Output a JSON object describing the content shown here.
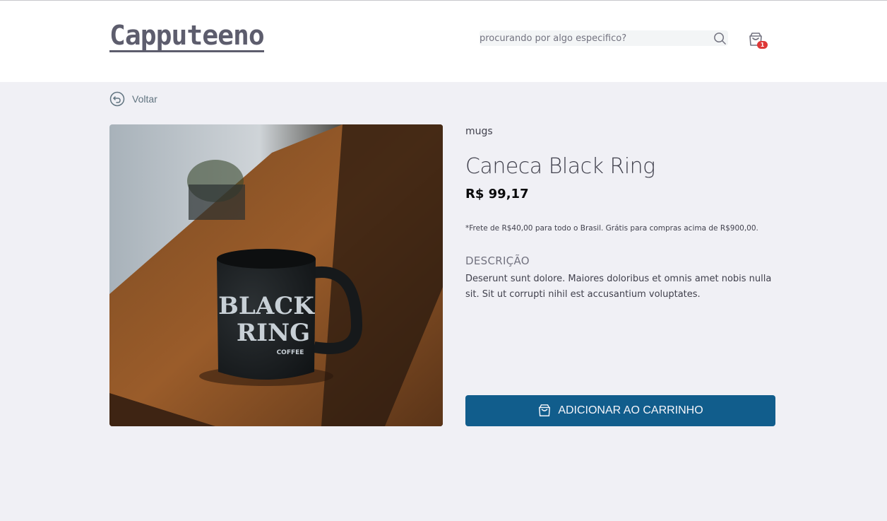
{
  "header": {
    "logo": "Capputeeno",
    "search_placeholder": "procurando por algo especifico?",
    "cart_count": "1"
  },
  "nav": {
    "back_label": "Voltar"
  },
  "product": {
    "category": "mugs",
    "name": "Caneca Black Ring",
    "price": "R$ 99,17",
    "shipping_note": "*Frete de R$40,00 para todo o Brasil. Grátis para compras acima de R$900,00.",
    "description_label": "DESCRIÇÃO",
    "description": "Deserunt sunt dolore. Maiores doloribus et omnis amet nobis nulla sit. Sit ut corrupti nihil est accusantium voluptates.",
    "image_text": [
      "BLACK",
      "RING",
      "COFFEE"
    ]
  },
  "actions": {
    "add_to_cart_label": "ADICIONAR AO CARRINHO"
  },
  "colors": {
    "primary": "#115d8c",
    "badge": "#de3838",
    "background": "#f0f0f5",
    "text": "#41414d"
  }
}
